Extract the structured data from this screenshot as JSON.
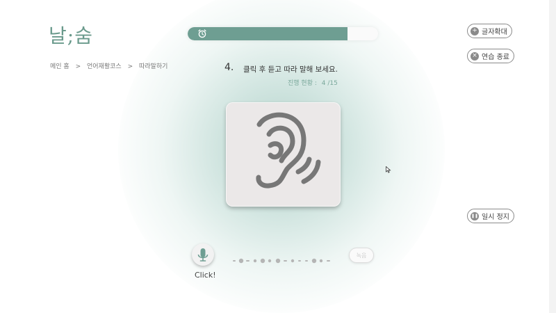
{
  "app": {
    "logo": "날;숨"
  },
  "breadcrumb": {
    "home": "메인 홈",
    "sep1": ">",
    "course": "언어재활코스",
    "sep2": ">",
    "current": "따라말하기"
  },
  "timer": {
    "remaining_fraction": 0.84,
    "icon": "alarm-clock-icon",
    "color": "#6e9e92"
  },
  "buttons": {
    "enlarge_text": "글자확대",
    "end_practice": "연습 종료",
    "pause": "일시 정지",
    "record_small": "녹음"
  },
  "question": {
    "number": "4.",
    "instruction": "클릭 후 듣고 따라 말해 보세요.",
    "progress_label": "진행 현황 :",
    "progress_value": "4 /15"
  },
  "card": {
    "icon": "ear-listen-icon"
  },
  "mic": {
    "icon": "microphone-icon",
    "label": "Click!"
  },
  "colors": {
    "accent": "#6e9e92",
    "card": "#ebe8e8"
  }
}
